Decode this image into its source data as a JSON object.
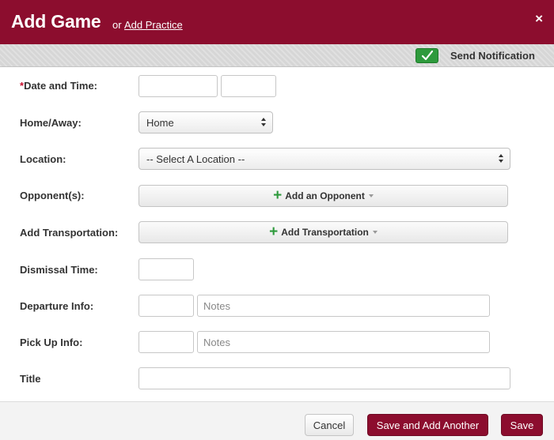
{
  "header": {
    "title": "Add Game",
    "or_text": "or",
    "add_practice_link": "Add Practice",
    "close_icon": "×"
  },
  "notification": {
    "label": "Send Notification",
    "checked": true,
    "icon": "checkmark-icon"
  },
  "form": {
    "date_time": {
      "required_marker": "*",
      "label": "Date and Time:",
      "date_value": "",
      "time_value": ""
    },
    "home_away": {
      "label": "Home/Away:",
      "selected": "Home"
    },
    "location": {
      "label": "Location:",
      "selected": "-- Select A Location --"
    },
    "opponents": {
      "label": "Opponent(s):",
      "button_label": "Add an Opponent"
    },
    "transportation": {
      "label": "Add Transportation:",
      "button_label": "Add Transportation"
    },
    "dismissal_time": {
      "label": "Dismissal Time:",
      "value": ""
    },
    "departure_info": {
      "label": "Departure Info:",
      "time_value": "",
      "notes_placeholder": "Notes"
    },
    "pickup_info": {
      "label": "Pick Up Info:",
      "time_value": "",
      "notes_placeholder": "Notes"
    },
    "title": {
      "label": "Title",
      "value": ""
    }
  },
  "footer": {
    "cancel_label": "Cancel",
    "save_another_label": "Save and Add Another",
    "save_label": "Save"
  },
  "colors": {
    "brand": "#8c0d2e",
    "success_green": "#2e9a3c",
    "required_red": "#c8102e"
  }
}
